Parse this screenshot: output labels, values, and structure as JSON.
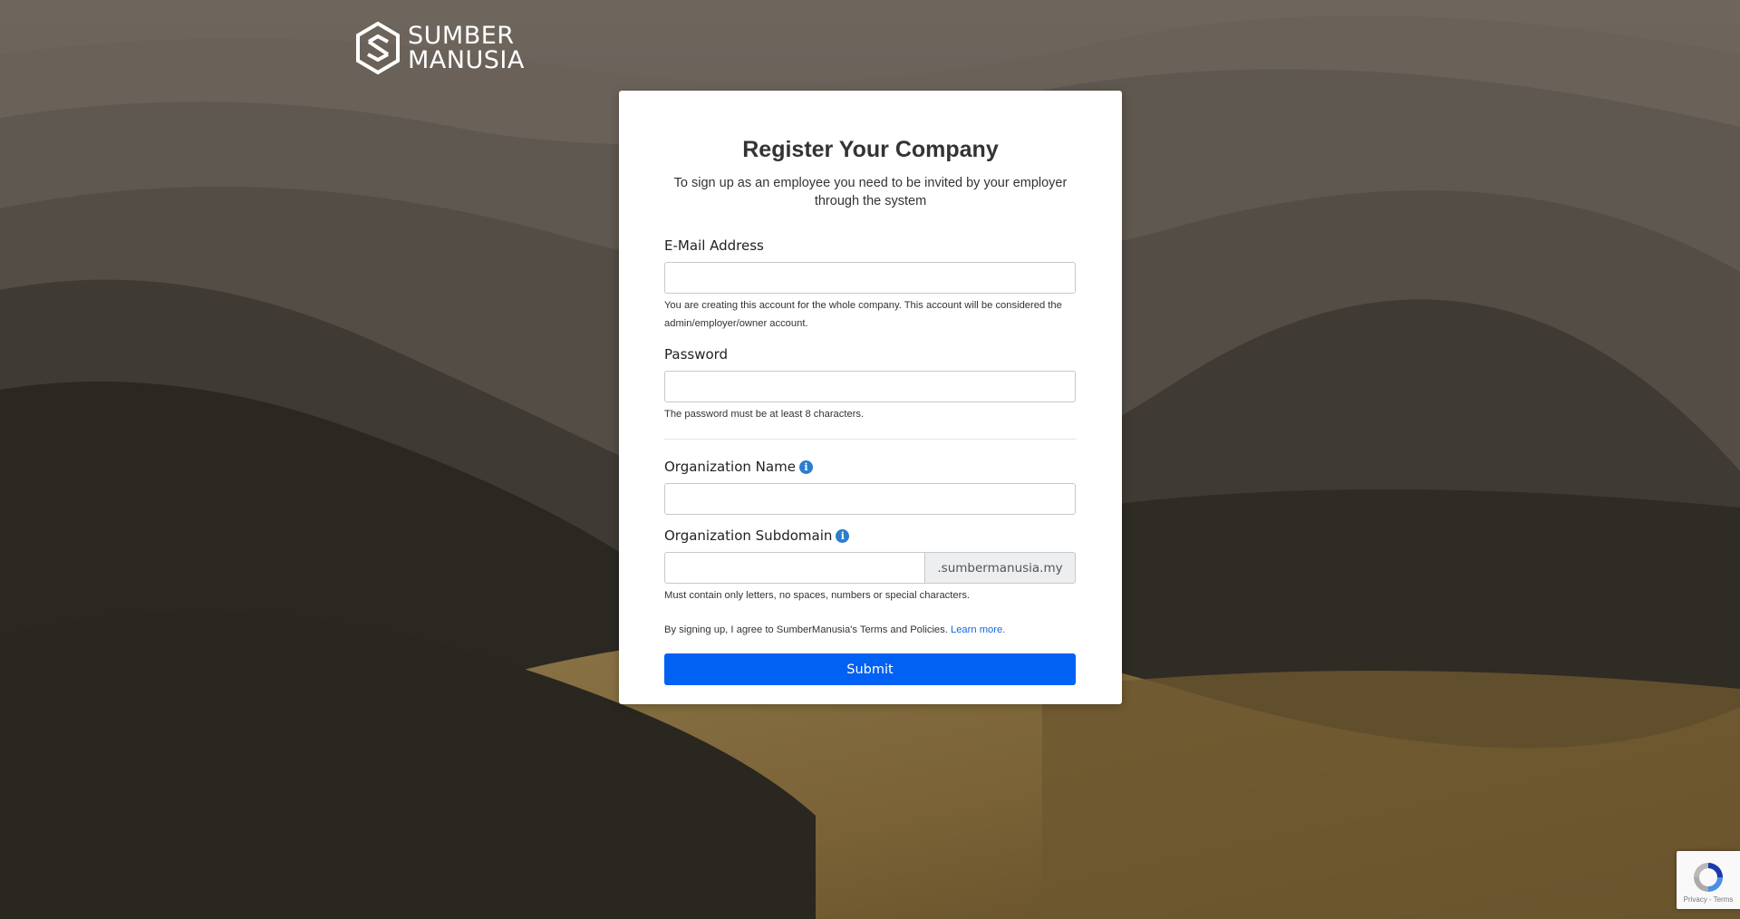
{
  "logo": {
    "line1": "SUMBER",
    "line2": "MANUSIA"
  },
  "form": {
    "title": "Register Your Company",
    "subtitle": "To sign up as an employee you need to be invited by your employer through the system",
    "email": {
      "label": "E-Mail Address",
      "value": "",
      "help": "You are creating this account for the whole company. This account will be considered the admin/employer/owner account."
    },
    "password": {
      "label": "Password",
      "value": "",
      "help": "The password must be at least 8 characters."
    },
    "organization_name": {
      "label": "Organization Name",
      "value": "",
      "info_icon": "info-icon"
    },
    "organization_subdomain": {
      "label": "Organization Subdomain",
      "value": "",
      "suffix": ".sumbermanusia.my",
      "help": "Must contain only letters, no spaces, numbers or special characters.",
      "info_icon": "info-icon"
    },
    "terms": {
      "text": "By signing up, I agree to SumberManusia's Terms and Policies.",
      "link": "Learn more."
    },
    "submit_label": "Submit"
  },
  "recaptcha": {
    "privacy": "Privacy",
    "separator": "-",
    "terms": "Terms"
  },
  "colors": {
    "primary": "#0061f2",
    "link": "#1467e0",
    "info": "#2c7dce"
  }
}
